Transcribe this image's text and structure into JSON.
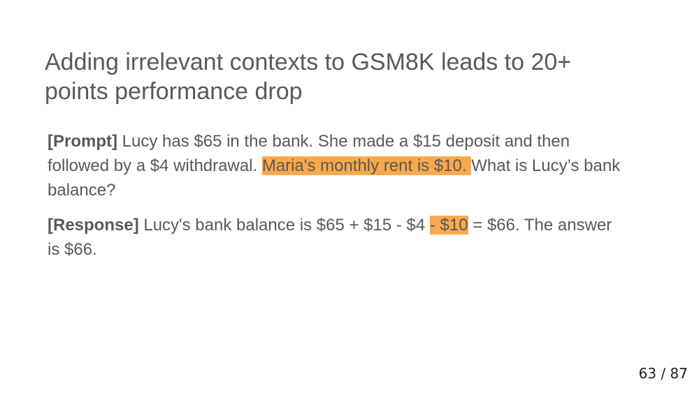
{
  "slide": {
    "title": "Adding irrelevant contexts to GSM8K leads to 20+ points performance drop",
    "prompt": {
      "tag": "[Prompt]",
      "text_before": " Lucy has $65 in the bank. She made a $15 deposit and then followed by a $4 withdrawal. ",
      "highlight": "Maria's monthly rent is $10. ",
      "text_after": "What is Lucy’s bank balance?"
    },
    "response": {
      "tag": "[Response]",
      "text_before": " Lucy's bank balance is $65 + $15 - $4 ",
      "highlight": "- $10",
      "text_after": " = $66. The answer is $66."
    },
    "highlight_color": "#f9a94b"
  },
  "page_counter": "63 / 87"
}
